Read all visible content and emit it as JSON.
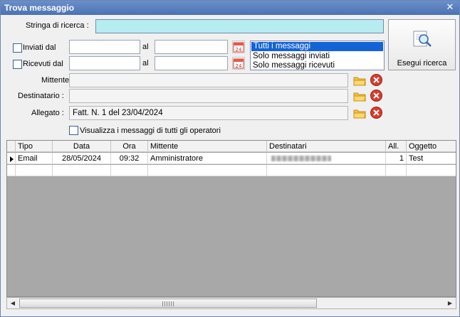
{
  "window": {
    "title": "Trova messaggio"
  },
  "form": {
    "search_label": "Stringa di ricerca :",
    "search_value": "",
    "sent_label": "Inviati dal",
    "received_label": "Ricevuti dal",
    "al_label": "al",
    "calendar_day": "24",
    "sender_label": "Mittente :",
    "recipient_label": "Destinatario :",
    "attachment_label": "Allegato :",
    "attachment_value": "Fatt. N. 1 del 23/04/2024",
    "all_operators_label": "Visualizza i messaggi di tutti gli operatori"
  },
  "filter_list": {
    "options": [
      "Tutti i messaggi",
      "Solo messaggi inviati",
      "Solo messaggi ricevuti"
    ],
    "selected": "Tutti i messaggi"
  },
  "search_button": {
    "label": "Esegui ricerca"
  },
  "grid": {
    "columns": [
      "Tipo",
      "Data",
      "Ora",
      "Mittente",
      "Destinatari",
      "All.",
      "Oggetto"
    ],
    "rows": [
      {
        "tipo": "Email",
        "data": "28/05/2024",
        "ora": "09:32",
        "mittente": "Amministratore",
        "destinatari": "",
        "all": "1",
        "oggetto": "Test"
      }
    ]
  },
  "colors": {
    "accent": "#4a72b3",
    "search_field": "#b7ecf0",
    "selection": "#1463d6",
    "grid_bg": "#a8a8a8"
  }
}
